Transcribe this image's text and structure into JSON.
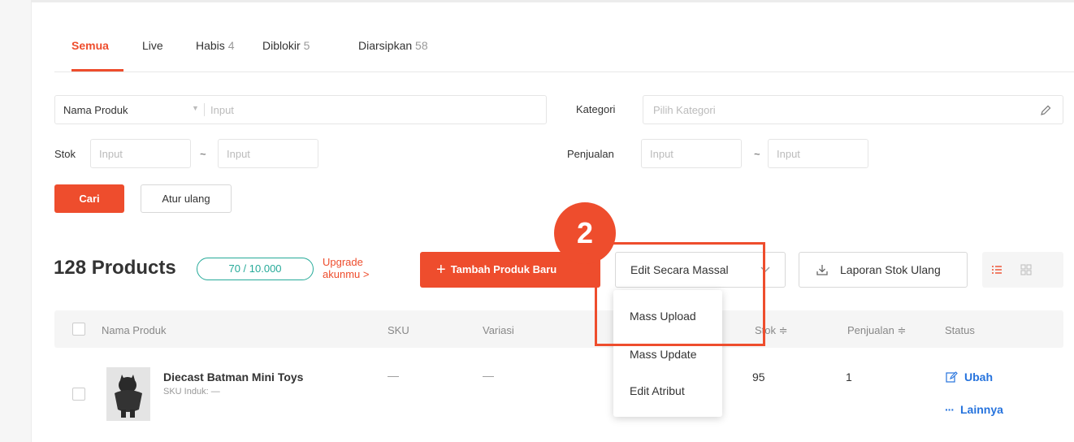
{
  "tabs": [
    {
      "label": "Semua",
      "count": ""
    },
    {
      "label": "Live",
      "count": ""
    },
    {
      "label": "Habis",
      "count": "4"
    },
    {
      "label": "Diblokir",
      "count": "5"
    },
    {
      "label": "Diarsipkan",
      "count": "58"
    }
  ],
  "filters": {
    "name_select": "Nama Produk",
    "name_input_placeholder": "Input",
    "category_label": "Kategori",
    "category_placeholder": "Pilih Kategori",
    "stock_label": "Stok",
    "stock_min_placeholder": "Input",
    "stock_max_placeholder": "Input",
    "range_sep": "~",
    "sales_label": "Penjualan",
    "sales_min_placeholder": "Input",
    "sales_max_placeholder": "Input",
    "search_button": "Cari",
    "reset_button": "Atur ulang"
  },
  "summary": {
    "title": "128 Products",
    "quota": "70 / 10.000",
    "upgrade_line1": "Upgrade",
    "upgrade_line2": "akunmu >"
  },
  "actions": {
    "add_product": "Tambah Produk Baru",
    "add_symbol": "+",
    "mass_edit": "Edit Secara Massal",
    "restock_report": "Laporan Stok Ulang"
  },
  "mass_edit_menu": [
    "Mass Upload",
    "Mass Update",
    "Edit Atribut"
  ],
  "step_badge": "2",
  "table": {
    "columns": [
      "Nama Produk",
      "SKU",
      "Variasi",
      "Stok ≑",
      "Penjualan ≑",
      "Status"
    ],
    "rows": [
      {
        "name": "Diecast Batman Mini Toys",
        "parent_sku": "SKU Induk: —",
        "sku": "—",
        "variation": "—",
        "stock": "95",
        "sales": "1",
        "edit_action": "Ubah",
        "more_action": "Lainnya"
      }
    ]
  },
  "colors": {
    "accent": "#ee4d2d",
    "link": "#2673dd",
    "quota": "#26aa99"
  }
}
